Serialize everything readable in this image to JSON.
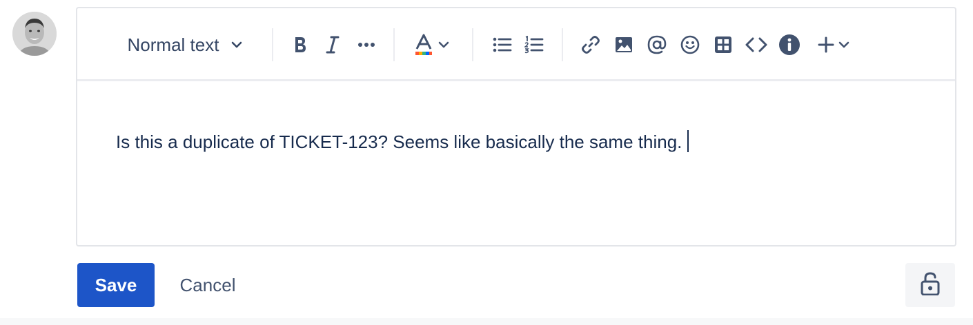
{
  "avatar": {
    "icon": "user-avatar-photo"
  },
  "toolbar": {
    "text_style": "Normal text",
    "icons": {
      "text_style_dropdown": "chevron-down-icon",
      "bold": "bold-icon",
      "italic": "italic-icon",
      "more_formatting": "more-icon",
      "text_color": "text-color-icon",
      "bullet_list": "bullet-list-icon",
      "numbered_list": "numbered-list-icon",
      "link": "link-icon",
      "image": "image-icon",
      "mention": "mention-icon",
      "emoji": "emoji-icon",
      "table": "table-icon",
      "code": "code-icon",
      "info": "info-icon",
      "insert": "plus-icon"
    },
    "text_color_stripe": [
      "#ff5630",
      "#ffab00",
      "#36b37e",
      "#0065ff",
      "#6554c0"
    ]
  },
  "editor": {
    "content": "Is this a duplicate of TICKET-123? Seems like basically the same thing."
  },
  "actions": {
    "save_label": "Save",
    "cancel_label": "Cancel",
    "restrictions_icon": "unlock-icon"
  },
  "colors": {
    "primary": "#1d55c8",
    "toolbar_icon": "#42526e",
    "text": "#172b4d",
    "border": "#e3e5e9"
  }
}
